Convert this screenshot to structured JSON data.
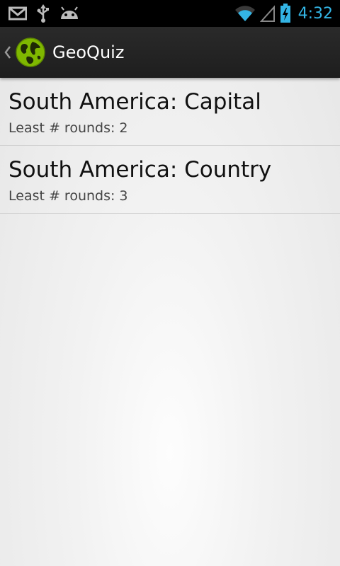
{
  "status_bar": {
    "time": "4:32",
    "icons": [
      "gmail-icon",
      "usb-icon",
      "android-debug-icon",
      "wifi-icon",
      "cell-signal-icon",
      "battery-charging-icon"
    ],
    "accent_color": "#33b5e5"
  },
  "action_bar": {
    "title": "GeoQuiz",
    "icon": "globe-icon",
    "icon_color": "#7fb800"
  },
  "quizzes": [
    {
      "title": "South America: Capital",
      "subtitle": "Least # rounds: 2"
    },
    {
      "title": "South America: Country",
      "subtitle": "Least # rounds: 3"
    }
  ]
}
